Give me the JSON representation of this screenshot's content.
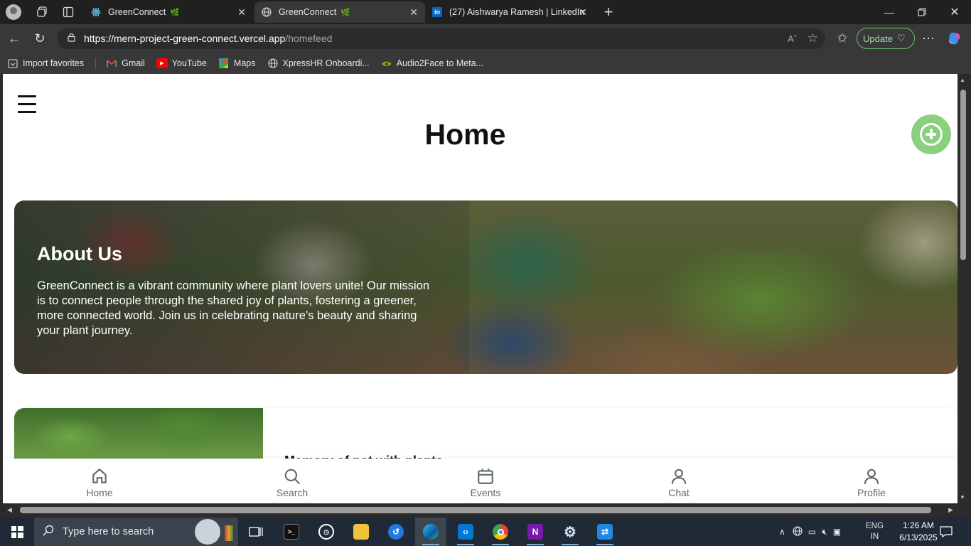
{
  "browser": {
    "tabs": [
      {
        "title": "GreenConnect",
        "active": false
      },
      {
        "title": "GreenConnect",
        "active": true
      },
      {
        "title": "(27) Aishwarya Ramesh | LinkedIn",
        "active": false
      }
    ],
    "address": {
      "host": "https://mern-project-green-connect.vercel.app",
      "path": "/homefeed"
    },
    "update_label": "Update",
    "bookmarks": [
      {
        "label": "Import favorites",
        "icon": "import-icon"
      },
      {
        "label": "Gmail",
        "icon": "gmail-icon"
      },
      {
        "label": "YouTube",
        "icon": "youtube-icon"
      },
      {
        "label": "Maps",
        "icon": "maps-icon"
      },
      {
        "label": "XpressHR Onboardi...",
        "icon": "globe-icon"
      },
      {
        "label": "Audio2Face to Meta...",
        "icon": "nvidia-icon"
      }
    ]
  },
  "page": {
    "title": "Home",
    "hero": {
      "title": "About Us",
      "text": "GreenConnect is a vibrant community where plant lovers unite! Our mission is to connect people through the shared joy of plants, fostering a greener, more connected world. Join us in celebrating nature’s beauty and sharing your plant journey."
    },
    "post": {
      "title": "Memory of pot with plants"
    },
    "bottom_nav": [
      {
        "label": "Home",
        "icon": "home-icon"
      },
      {
        "label": "Search",
        "icon": "search-icon"
      },
      {
        "label": "Events",
        "icon": "calendar-icon"
      },
      {
        "label": "Chat",
        "icon": "user-icon"
      },
      {
        "label": "Profile",
        "icon": "user-icon"
      }
    ],
    "accent_color": "#8bd07e"
  },
  "taskbar": {
    "search_placeholder": "Type here to search",
    "language": {
      "line1": "ENG",
      "line2": "IN"
    },
    "time": "1:26 AM",
    "date": "6/13/2025"
  }
}
